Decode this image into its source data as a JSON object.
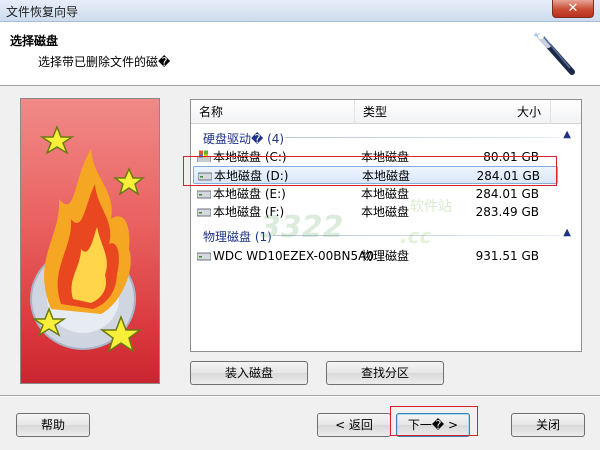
{
  "window": {
    "title": "文件恢复向导",
    "close_glyph": "✕"
  },
  "header": {
    "title": "选择磁盘",
    "subtitle": "选择带已删除文件的磁�",
    "icon": "magic-wand-icon"
  },
  "listview": {
    "columns": {
      "name": "名称",
      "type": "类型",
      "size": "大小"
    },
    "groups": [
      {
        "label": "硬盘驱动� (4)"
      },
      {
        "label": "物理磁盘 (1)"
      }
    ],
    "rows": [
      {
        "name": "本地磁盘 (C:)",
        "type": "本地磁盘",
        "size": "80.01 GB",
        "icon": "system-drive-icon"
      },
      {
        "name": "本地磁盘 (D:)",
        "type": "本地磁盘",
        "size": "284.01 GB",
        "icon": "drive-icon",
        "selected": true
      },
      {
        "name": "本地磁盘 (E:)",
        "type": "本地磁盘",
        "size": "284.01 GB",
        "icon": "drive-icon"
      },
      {
        "name": "本地磁盘 (F:)",
        "type": "本地磁盘",
        "size": "283.49 GB",
        "icon": "drive-icon"
      },
      {
        "name": "WDC WD10EZEX-00BN5A0",
        "type": "物理磁盘",
        "size": "931.51 GB",
        "icon": "drive-icon"
      }
    ],
    "group_chevron": "▲"
  },
  "buttons": {
    "mount_disk": "装入磁盘",
    "find_partitions": "查找分区",
    "help": "帮助",
    "back": "< 返回",
    "next": "下一� >",
    "close": "关闭"
  },
  "watermark": {
    "line1": "3322",
    "line2": ".cc",
    "line3": "软件站"
  },
  "colors": {
    "highlight_box": "#d6232a",
    "group_text": "#1e3287",
    "selection_border": "#84acdd"
  }
}
